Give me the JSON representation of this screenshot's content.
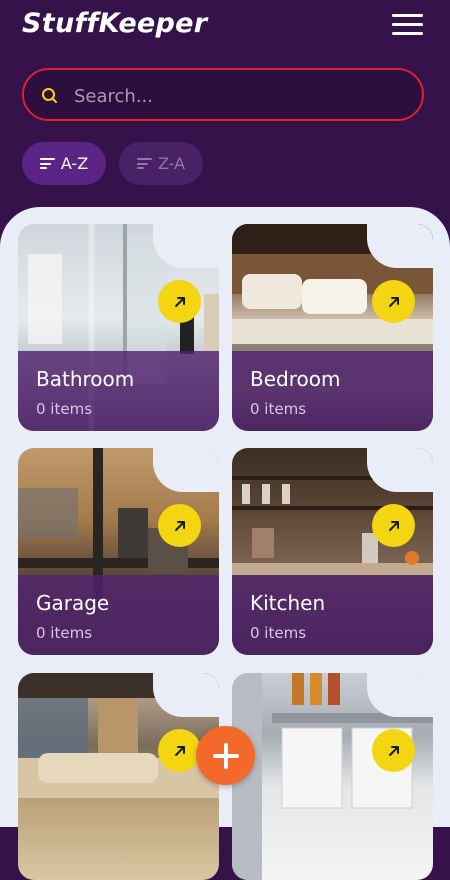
{
  "app": {
    "title": "StuffKeeper"
  },
  "search": {
    "placeholder": "Search..."
  },
  "sort": {
    "az_label": "A-Z",
    "za_label": "Z-A"
  },
  "rooms": [
    {
      "name": "Bathroom",
      "count": "0 items"
    },
    {
      "name": "Bedroom",
      "count": "0 items"
    },
    {
      "name": "Garage",
      "count": "0 items"
    },
    {
      "name": "Kitchen",
      "count": "0 items"
    }
  ],
  "colors": {
    "background": "#35124a",
    "accent_yellow": "#f3d511",
    "fab_orange": "#f2692b",
    "search_border": "#e0202e",
    "content_bg": "#e9edf8"
  },
  "icons": {
    "menu": "hamburger-menu-icon",
    "search": "search-icon",
    "sort": "sort-lines-icon",
    "open": "arrow-up-right-icon",
    "add": "plus-icon"
  }
}
